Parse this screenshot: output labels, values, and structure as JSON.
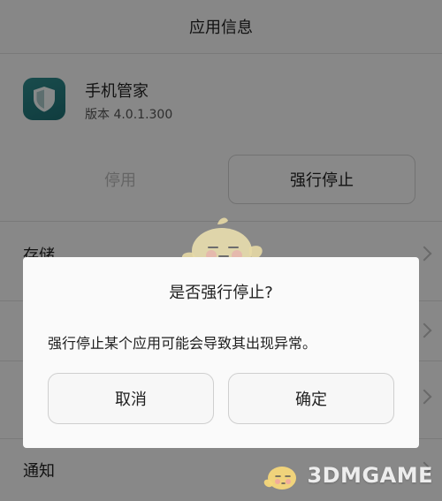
{
  "header": {
    "title": "应用信息"
  },
  "app": {
    "name": "手机管家",
    "version": "版本 4.0.1.300",
    "icon": "shield-icon"
  },
  "actions": {
    "disable_label": "停用",
    "force_stop_label": "强行停止"
  },
  "list": {
    "items": [
      {
        "label": "存储"
      },
      {
        "label": "通知"
      }
    ]
  },
  "dialog": {
    "title": "是否强行停止?",
    "message": "强行停止某个应用可能会导致其出现异常。",
    "cancel_label": "取消",
    "ok_label": "确定"
  },
  "watermark": {
    "text": "3DMGAME"
  },
  "colors": {
    "app_icon": "#2e8a8c",
    "overlay": "#000000"
  }
}
